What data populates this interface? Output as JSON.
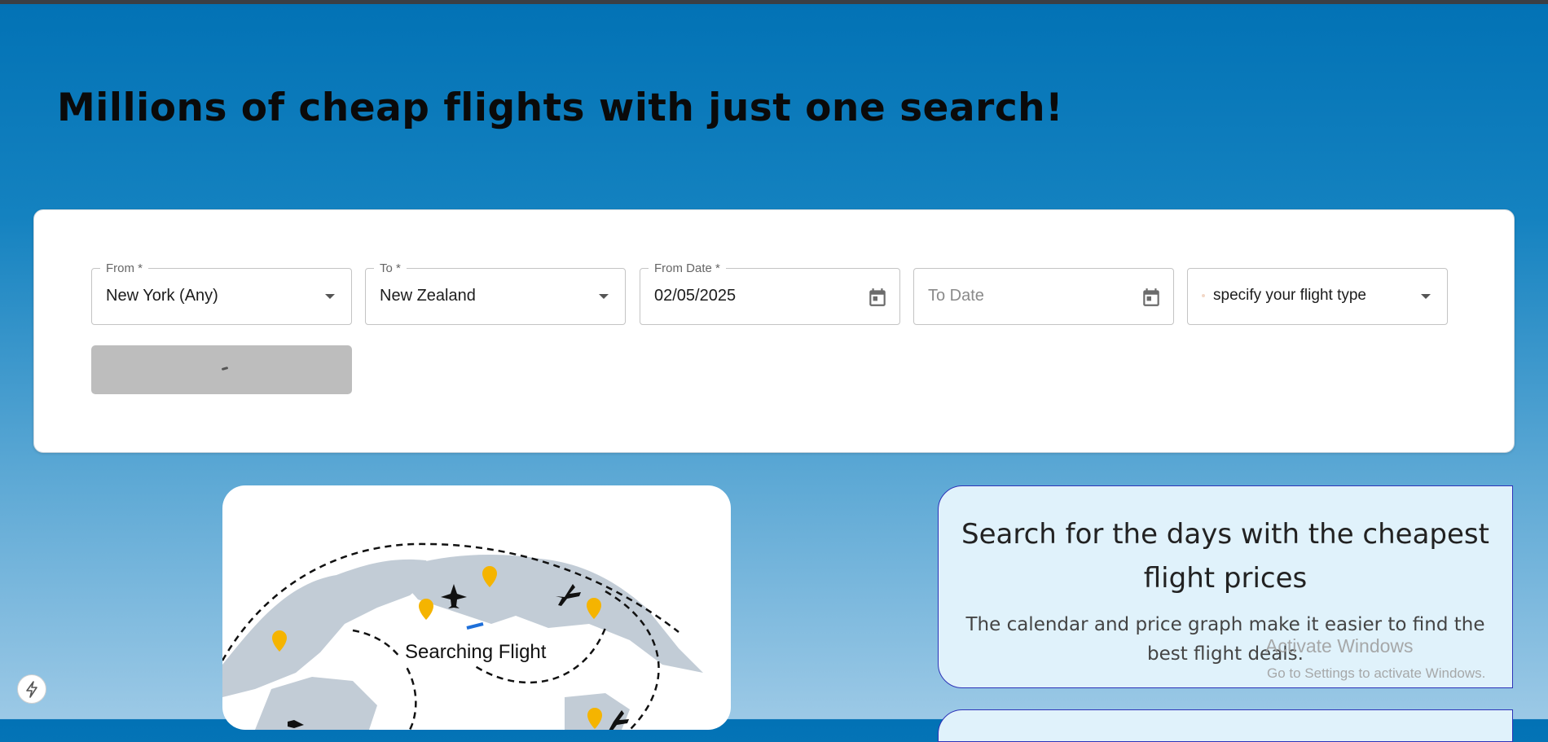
{
  "headline": "Millions of cheap flights with just one search!",
  "search_form": {
    "from": {
      "label": "From *",
      "value": "New York (Any)"
    },
    "to": {
      "label": "To *",
      "value": "New Zealand"
    },
    "from_date": {
      "label": "From Date *",
      "value": "02/05/2025"
    },
    "to_date": {
      "placeholder": "To Date"
    },
    "flight_type": {
      "value": "specify your flight type"
    }
  },
  "animation": {
    "label": "Searching Flight"
  },
  "info_card": {
    "title": "Search for the days with the cheapest flight prices",
    "description": "The calendar and price graph make it easier to find the best flight deals."
  },
  "watermark": {
    "line1": "Activate Windows",
    "line2": "Go to Settings to activate Windows."
  },
  "colors": {
    "accent": "#0272b5",
    "pin": "#f5b400",
    "card_border": "#2d33b8"
  }
}
